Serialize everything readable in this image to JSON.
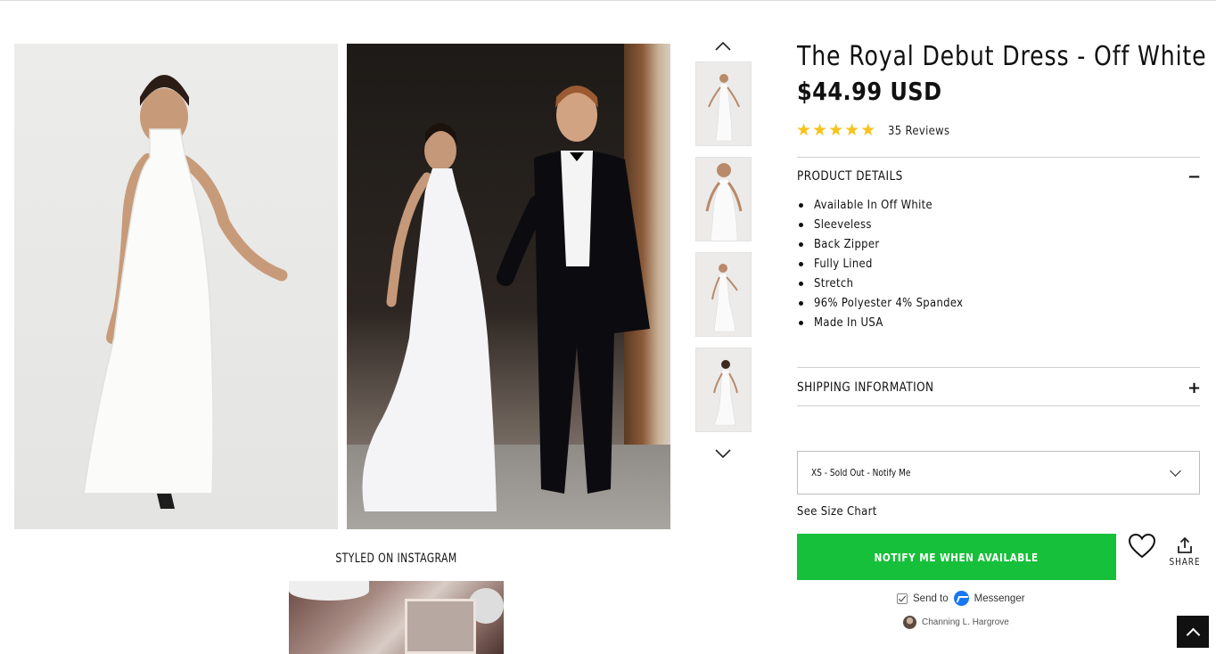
{
  "gallery": {
    "main_images": [
      "model-front-view",
      "wedding-couple-photo"
    ],
    "thumbnails": [
      "model-front-full",
      "model-front-closeup",
      "model-front-walk",
      "model-back-view"
    ]
  },
  "instagram": {
    "title": "STYLED ON INSTAGRAM"
  },
  "product": {
    "title": "The Royal Debut Dress - Off White",
    "price": "$44.99 USD",
    "rating": 5,
    "reviews_label": "35 Reviews"
  },
  "details_section": {
    "label": "PRODUCT DETAILS",
    "toggle": "−",
    "items": [
      "Available In Off White",
      "Sleeveless",
      "Back Zipper",
      "Fully Lined",
      "Stretch",
      "96% Polyester 4% Spandex",
      "Made In USA"
    ]
  },
  "shipping_section": {
    "label": "SHIPPING INFORMATION",
    "toggle": "+"
  },
  "size_select": {
    "selected": "XS - Sold Out - Notify Me"
  },
  "size_chart_link": "See Size Chart",
  "notify_button": "NOTIFY ME WHEN AVAILABLE",
  "share_label": "SHARE",
  "messenger": {
    "send_to": "Send to",
    "app": "Messenger"
  },
  "user_name": "Channing L. Hargrove",
  "colors": {
    "accent_green": "#17c03a",
    "star_yellow": "#f6c21c",
    "messenger_blue": "#1877f2"
  }
}
